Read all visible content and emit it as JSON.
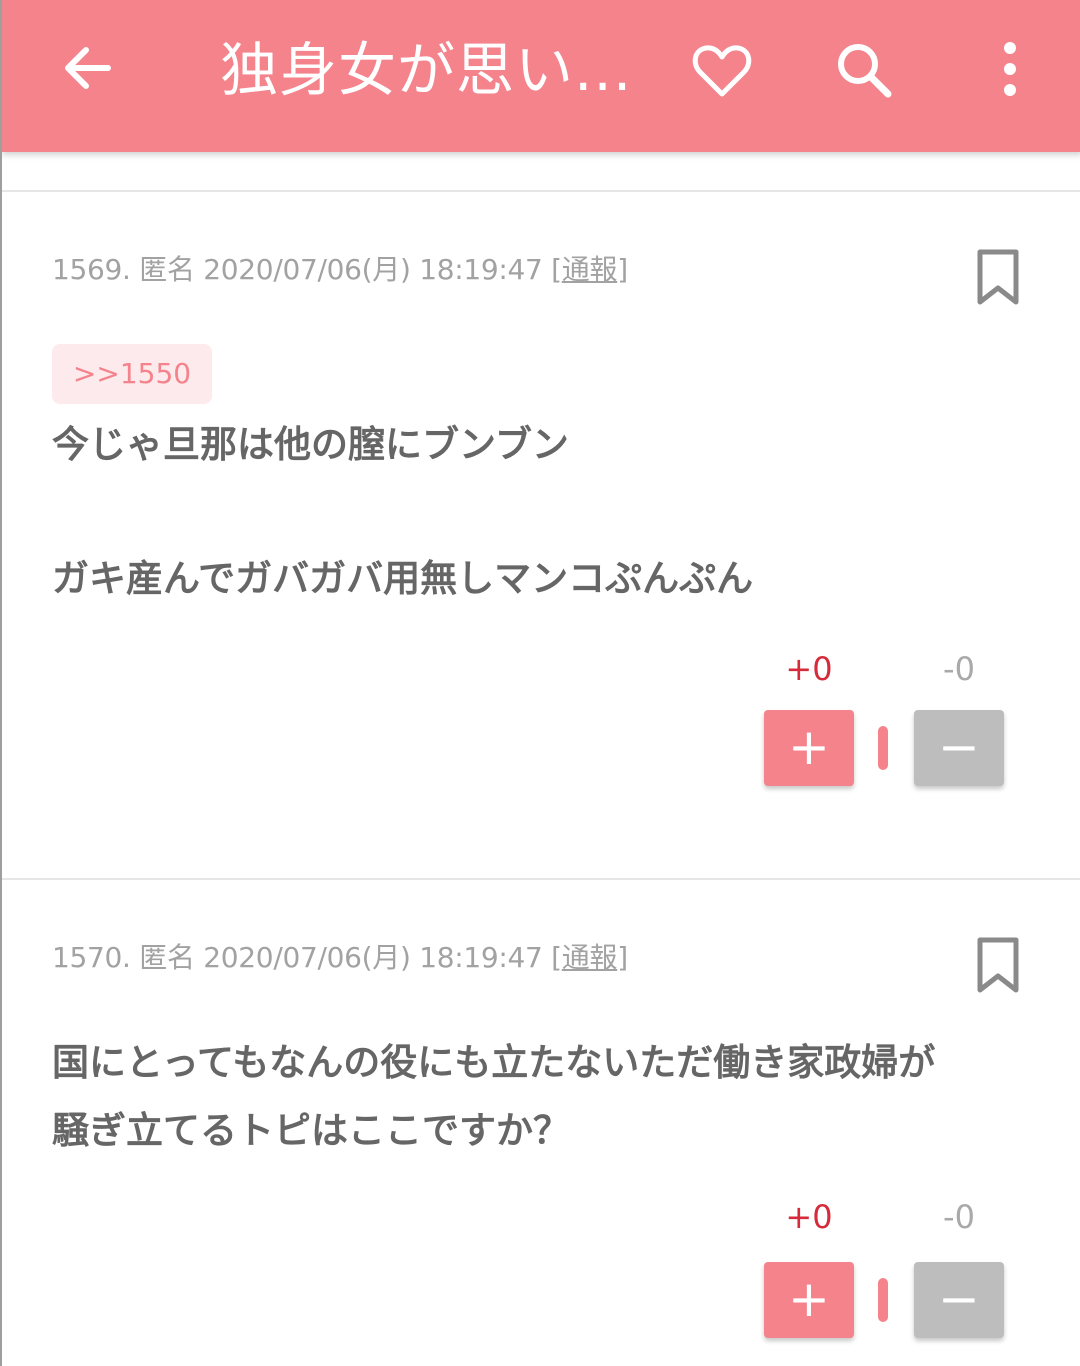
{
  "appbar": {
    "title": "独身女が思い...",
    "icons": [
      "back-arrow-icon",
      "heart-icon",
      "search-icon",
      "more-vert-icon"
    ],
    "color": "#f4838c"
  },
  "posts": [
    {
      "meta_prefix": "1569. 匿名 2020/07/06(月) 18:19:47 [",
      "report": "通報",
      "meta_suffix": "]",
      "anchor": ">>1550",
      "lines": [
        "今じゃ旦那は他の膣にブンブン",
        "ガキ産んでガバガバ用無しマンコぷんぷん"
      ],
      "plus_count": "+0",
      "minus_count": "-0",
      "plus_label": "+",
      "minus_label": "−"
    },
    {
      "meta_prefix": "1570. 匿名 2020/07/06(月) 18:19:47 [",
      "report": "通報",
      "meta_suffix": "]",
      "lines": [
        "国にとってもなんの役にも立たないただ働き家政婦が",
        "騒ぎ立てるトピはここですか？"
      ],
      "plus_count": "+0",
      "minus_count": "-0",
      "plus_label": "+",
      "minus_label": "−"
    }
  ],
  "colors": {
    "accent": "#f4838c",
    "plus_count": "#d52b3a",
    "minus_button": "#bdbdbd"
  }
}
